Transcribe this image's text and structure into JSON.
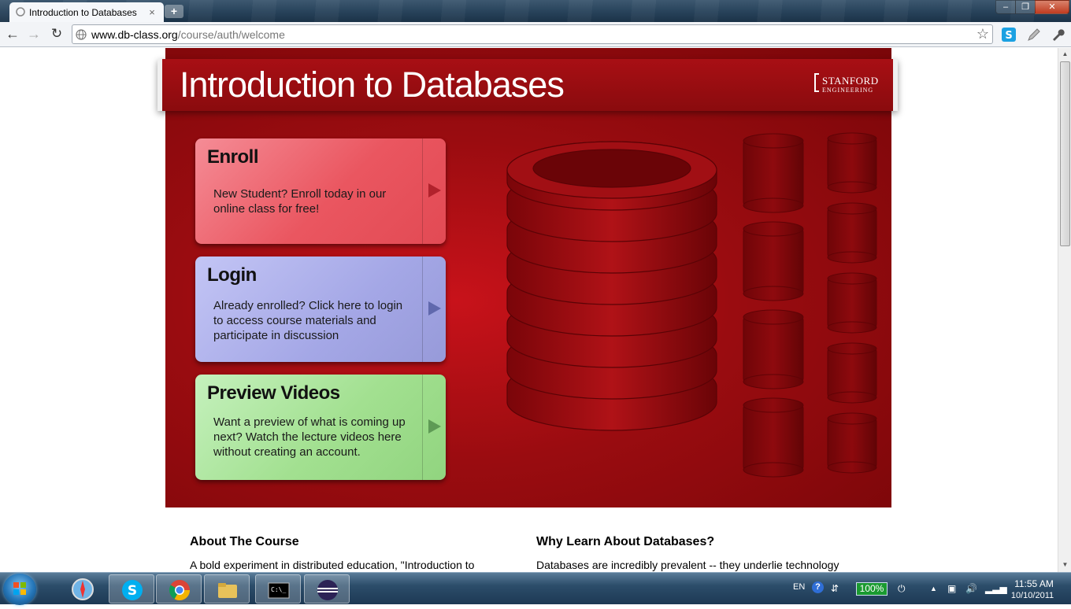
{
  "browser": {
    "tab_title": "Introduction to Databases",
    "tab_close": "×",
    "newtab": "+",
    "url_host": "www.db-class.org",
    "url_path": "/course/auth/welcome",
    "window_controls": {
      "minimize": "‒",
      "maximize": "❐",
      "close": "✕"
    },
    "nav": {
      "back": "←",
      "forward": "→",
      "reload": "↻",
      "star": "☆"
    }
  },
  "page": {
    "site_title": "Introduction to Databases",
    "logo": {
      "line1": "STANFORD",
      "line2": "ENGINEERING"
    },
    "cards": {
      "enroll": {
        "title": "Enroll",
        "text": "New Student? Enroll today in our online class for free!"
      },
      "login": {
        "title": "Login",
        "text": "Already enrolled? Click here to login to access course materials and participate in discussion"
      },
      "preview": {
        "title": "Preview Videos",
        "text": "Want a preview of what is coming up next? Watch the lecture videos here without creating an account."
      }
    },
    "sections": {
      "about": {
        "heading": "About The Course",
        "text": "A bold experiment in distributed education, \"Introduction to"
      },
      "why": {
        "heading": "Why Learn About Databases?",
        "text": "Databases are incredibly prevalent -- they underlie technology"
      }
    }
  },
  "taskbar": {
    "language": "EN",
    "help": "?",
    "battery": "100%",
    "time": "11:55 AM",
    "date": "10/10/2011"
  },
  "colors": {
    "hero_red": "#9a0c10",
    "enroll": "#ea5660",
    "login": "#a4a7e6",
    "preview": "#a2e090"
  }
}
